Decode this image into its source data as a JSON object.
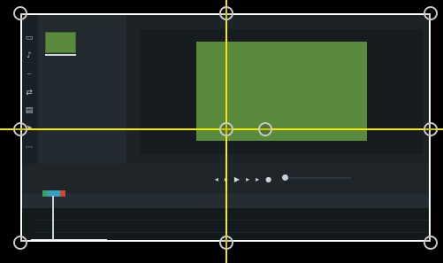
{
  "tools": [
    {
      "icon": "media-icon",
      "glyph": "▭"
    },
    {
      "icon": "mic-icon",
      "glyph": "♪"
    },
    {
      "icon": "annotation-icon",
      "glyph": "⎯"
    },
    {
      "icon": "transition-icon",
      "glyph": "⇄"
    },
    {
      "icon": "captions-icon",
      "glyph": "▤"
    },
    {
      "icon": "cursor-icon",
      "glyph": "➤"
    },
    {
      "icon": "more-icon",
      "glyph": "···"
    }
  ],
  "playback": {
    "controls": [
      {
        "icon": "skip-back-icon",
        "glyph": "◂"
      },
      {
        "icon": "step-back-icon",
        "glyph": "▸"
      },
      {
        "icon": "play-icon",
        "glyph": "▶"
      },
      {
        "icon": "step-forward-icon",
        "glyph": "▸"
      },
      {
        "icon": "skip-forward-icon",
        "glyph": "▸"
      },
      {
        "icon": "marker-icon",
        "glyph": "●"
      }
    ],
    "scrub_fraction": 0.0
  },
  "colors": {
    "accent_green": "#5a8a3d",
    "guide_yellow": "#f2ea00",
    "selection_border": "#ffffff"
  }
}
